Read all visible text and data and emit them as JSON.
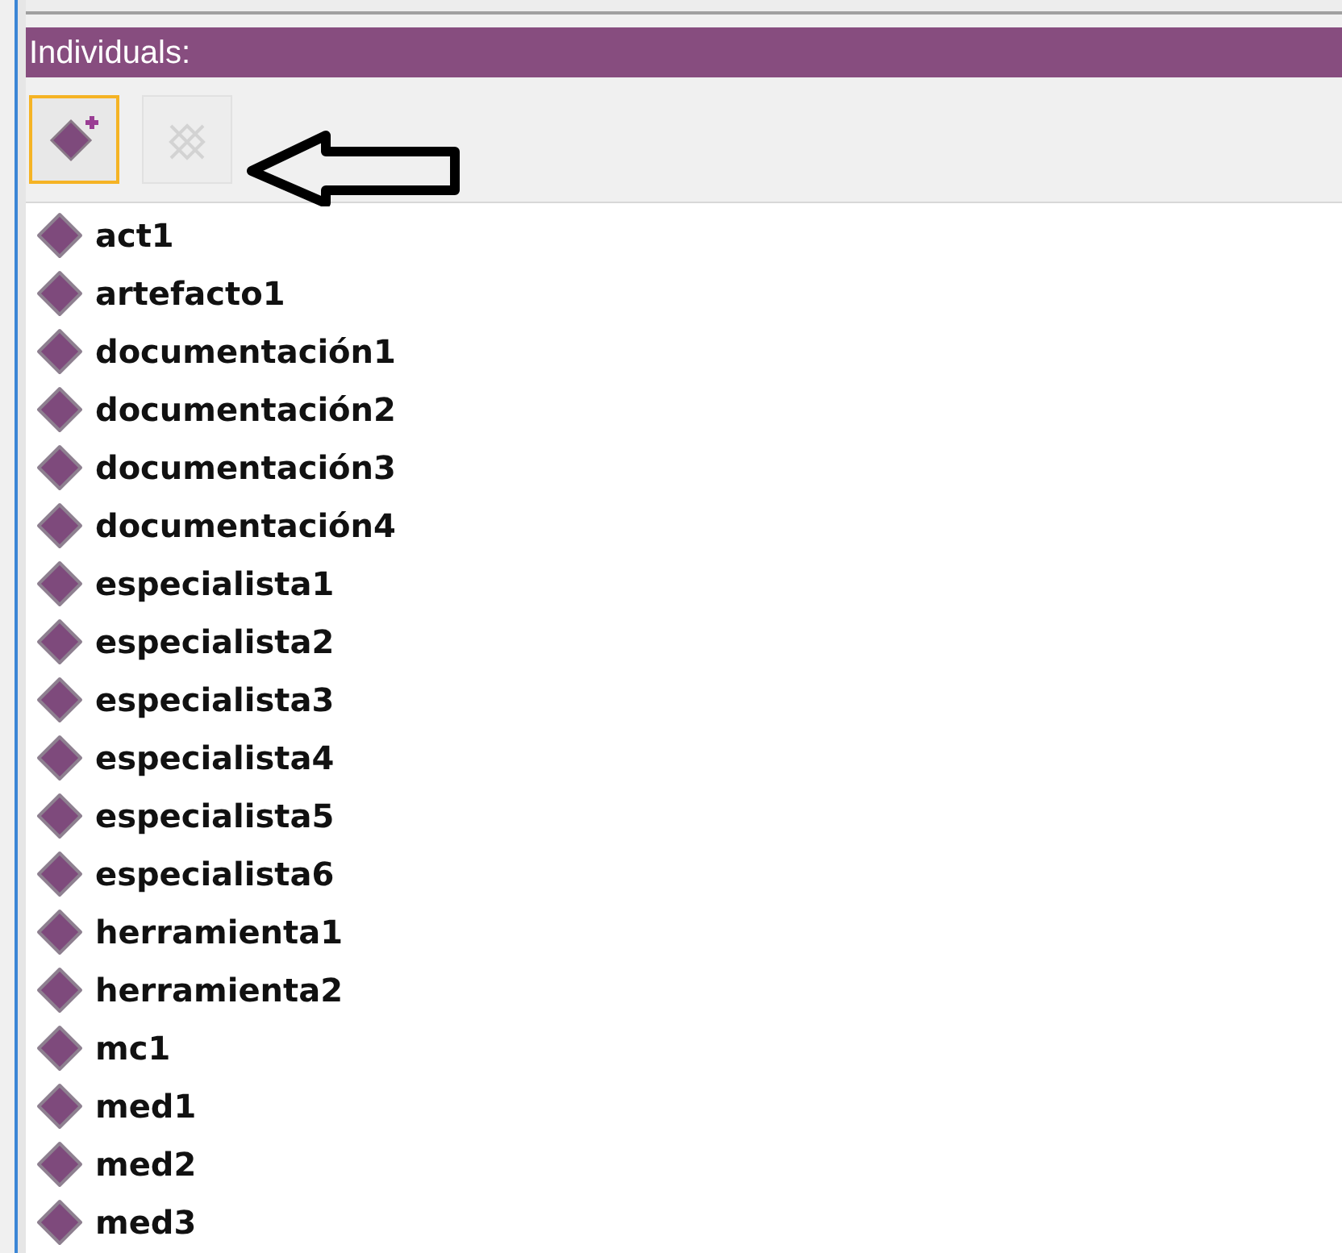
{
  "panel": {
    "title": "Individuals:"
  },
  "toolbar": [
    {
      "kind": "add",
      "disabled": false,
      "focused": true
    },
    {
      "kind": "delete",
      "disabled": true,
      "focused": false
    }
  ],
  "individuals": [
    {
      "name": "act1"
    },
    {
      "name": "artefacto1"
    },
    {
      "name": "documentación1"
    },
    {
      "name": "documentación2"
    },
    {
      "name": "documentación3"
    },
    {
      "name": "documentación4"
    },
    {
      "name": "especialista1"
    },
    {
      "name": "especialista2"
    },
    {
      "name": "especialista3"
    },
    {
      "name": "especialista4"
    },
    {
      "name": "especialista5"
    },
    {
      "name": "especialista6"
    },
    {
      "name": "herramienta1"
    },
    {
      "name": "herramienta2"
    },
    {
      "name": "mc1"
    },
    {
      "name": "med1"
    },
    {
      "name": "med2"
    },
    {
      "name": "med3"
    }
  ]
}
